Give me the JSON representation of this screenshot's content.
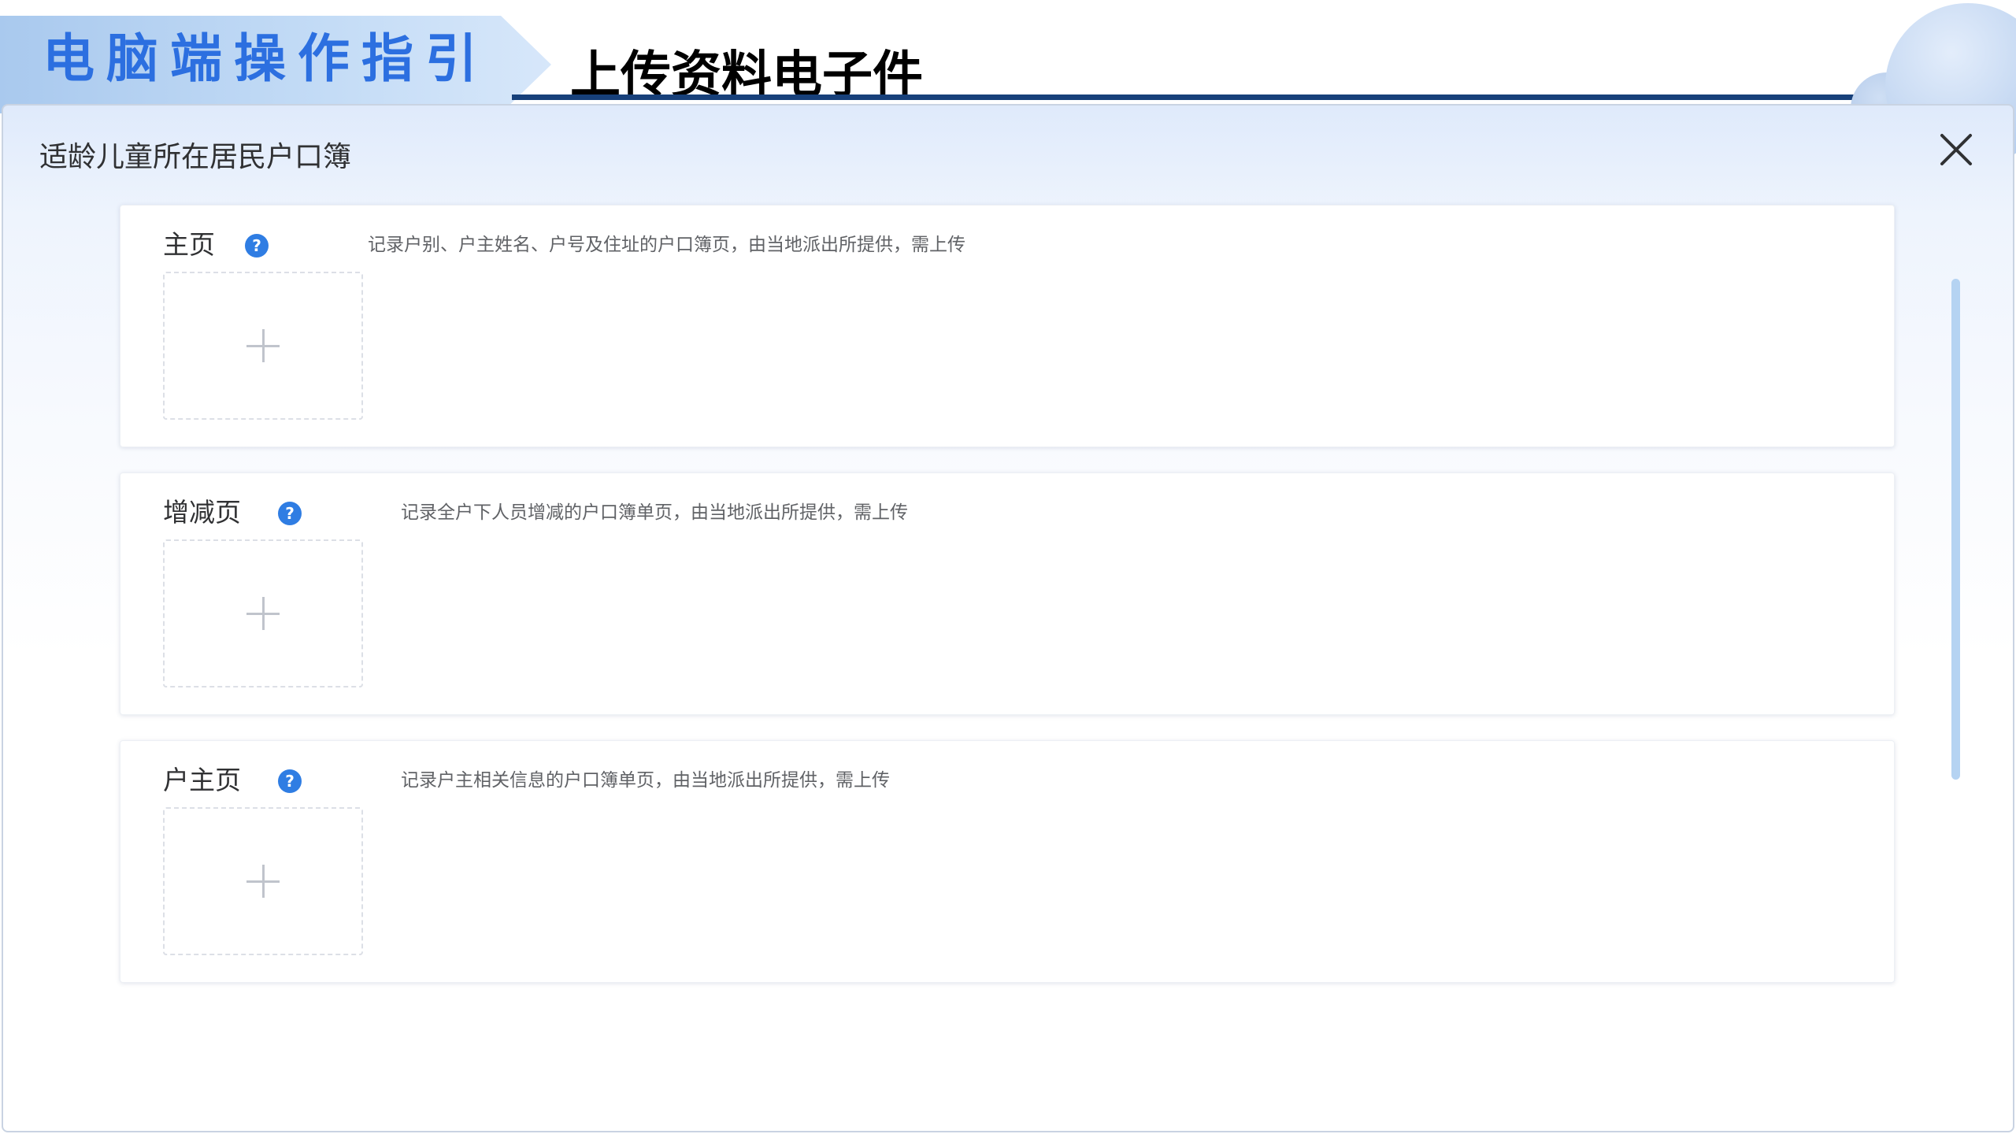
{
  "slide": {
    "guide_title": "电脑端操作指引",
    "section_title": "上传资料电子件"
  },
  "dialog": {
    "title": "适龄儿童所在居民户口簿",
    "close_icon": "close-icon",
    "cards": [
      {
        "label": "主页",
        "help_icon": "?",
        "description": "记录户别、户主姓名、户号及住址的户口簿页，由当地派出所提供，需上传",
        "upload_icon": "plus-icon"
      },
      {
        "label": "增减页",
        "help_icon": "?",
        "description": "记录全户下人员增减的户口簿单页，由当地派出所提供，需上传",
        "upload_icon": "plus-icon"
      },
      {
        "label": "户主页",
        "help_icon": "?",
        "description": "记录户主相关信息的户口簿单页，由当地派出所提供，需上传",
        "upload_icon": "plus-icon"
      }
    ]
  },
  "colors": {
    "accent": "#2f7de3",
    "guide_title": "#2c6fe0",
    "header_rule": "#17407a",
    "scroll_thumb": "#b5d3f2"
  }
}
